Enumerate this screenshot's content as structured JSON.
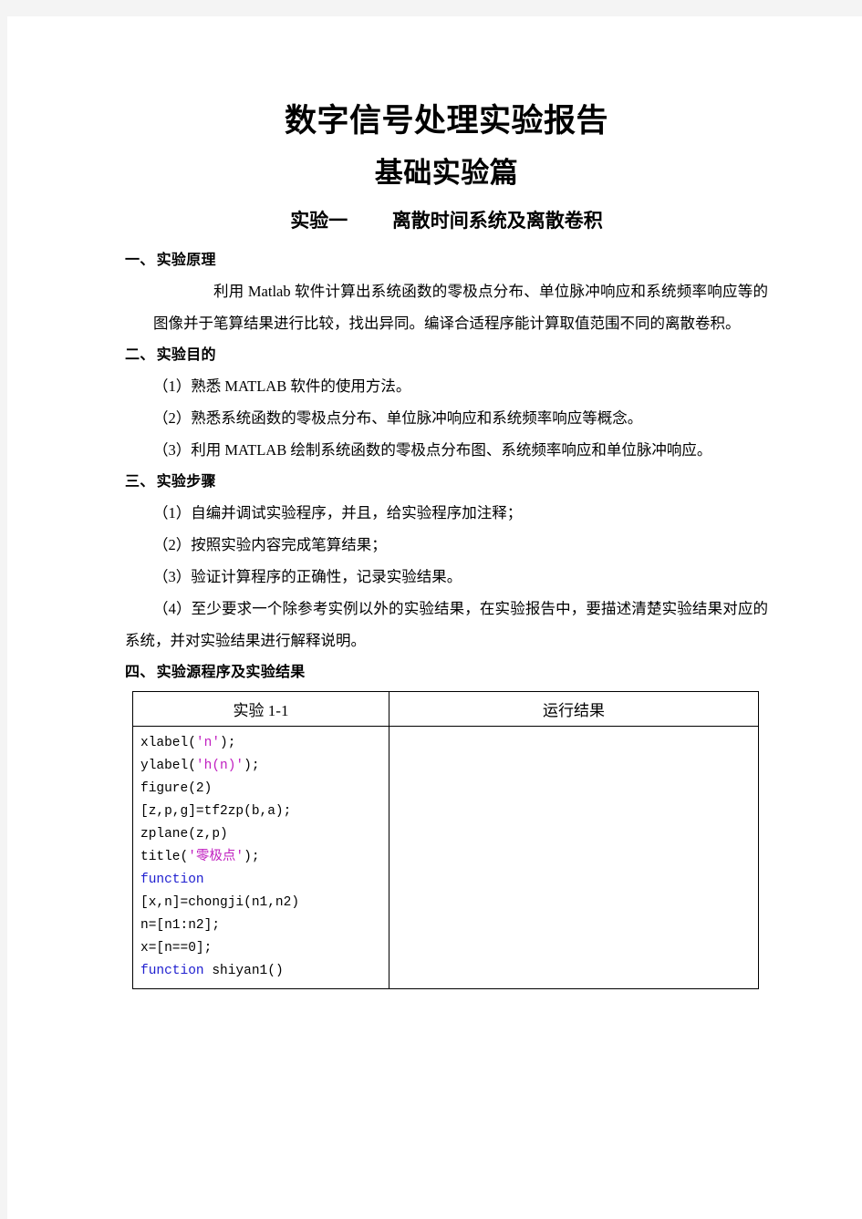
{
  "document": {
    "title": "数字信号处理实验报告",
    "subtitle": "基础实验篇",
    "experiment_label": "实验一",
    "experiment_name": "离散时间系统及离散卷积"
  },
  "sections": [
    {
      "number": "一、",
      "heading": "实验原理",
      "paragraphs": [
        "利用 Matlab 软件计算出系统函数的零极点分布、单位脉冲响应和系统频率响应等的图像并于笔算结果进行比较，找出异同。编译合适程序能计算取值范围不同的离散卷积。"
      ]
    },
    {
      "number": "二、",
      "heading": "实验目的",
      "paragraphs": [
        "（1）熟悉 MATLAB 软件的使用方法。",
        "（2）熟悉系统函数的零极点分布、单位脉冲响应和系统频率响应等概念。",
        "（3）利用 MATLAB 绘制系统函数的零极点分布图、系统频率响应和单位脉冲响应。"
      ]
    },
    {
      "number": "三、",
      "heading": "实验步骤",
      "paragraphs": [
        "（1）自编并调试实验程序，并且，给实验程序加注释；",
        "（2）按照实验内容完成笔算结果；",
        "（3）验证计算程序的正确性，记录实验结果。",
        "（4）至少要求一个除参考实例以外的实验结果，在实验报告中，要描述清楚实验结果对应的系统，并对实验结果进行解释说明。"
      ]
    },
    {
      "number": "四、",
      "heading": "实验源程序及实验结果",
      "paragraphs": []
    }
  ],
  "table": {
    "headers": {
      "code_column": "实验 1-1",
      "result_column": "运行结果"
    },
    "code_lines": [
      [
        {
          "t": "xlabel(",
          "c": "plain"
        },
        {
          "t": "'n'",
          "c": "str"
        },
        {
          "t": ");",
          "c": "plain"
        }
      ],
      [
        {
          "t": "ylabel(",
          "c": "plain"
        },
        {
          "t": "'h(n)'",
          "c": "str"
        },
        {
          "t": ");",
          "c": "plain"
        }
      ],
      [
        {
          "t": "figure(2)",
          "c": "plain"
        }
      ],
      [
        {
          "t": "[z,p,g]=tf2zp(b,a);",
          "c": "plain"
        }
      ],
      [
        {
          "t": "zplane(z,p)",
          "c": "plain"
        }
      ],
      [
        {
          "t": "title(",
          "c": "plain"
        },
        {
          "t": "'零极点'",
          "c": "str"
        },
        {
          "t": ");",
          "c": "plain"
        }
      ],
      [
        {
          "t": "function",
          "c": "kw"
        }
      ],
      [
        {
          "t": "[x,n]=chongji(n1,n2)",
          "c": "plain"
        }
      ],
      [
        {
          "t": "n=[n1:n2];",
          "c": "plain"
        }
      ],
      [
        {
          "t": "x=[n==0];",
          "c": "plain"
        }
      ],
      [
        {
          "t": "function",
          "c": "kw"
        },
        {
          "t": " shiyan1()",
          "c": "plain"
        }
      ]
    ],
    "result_cell_text": ""
  },
  "colors": {
    "page_background": "#ffffff",
    "canvas_background": "#f4f4f4",
    "text": "#000000",
    "code_string": "#c020c0",
    "code_keyword": "#2020d0",
    "table_border": "#000000"
  }
}
